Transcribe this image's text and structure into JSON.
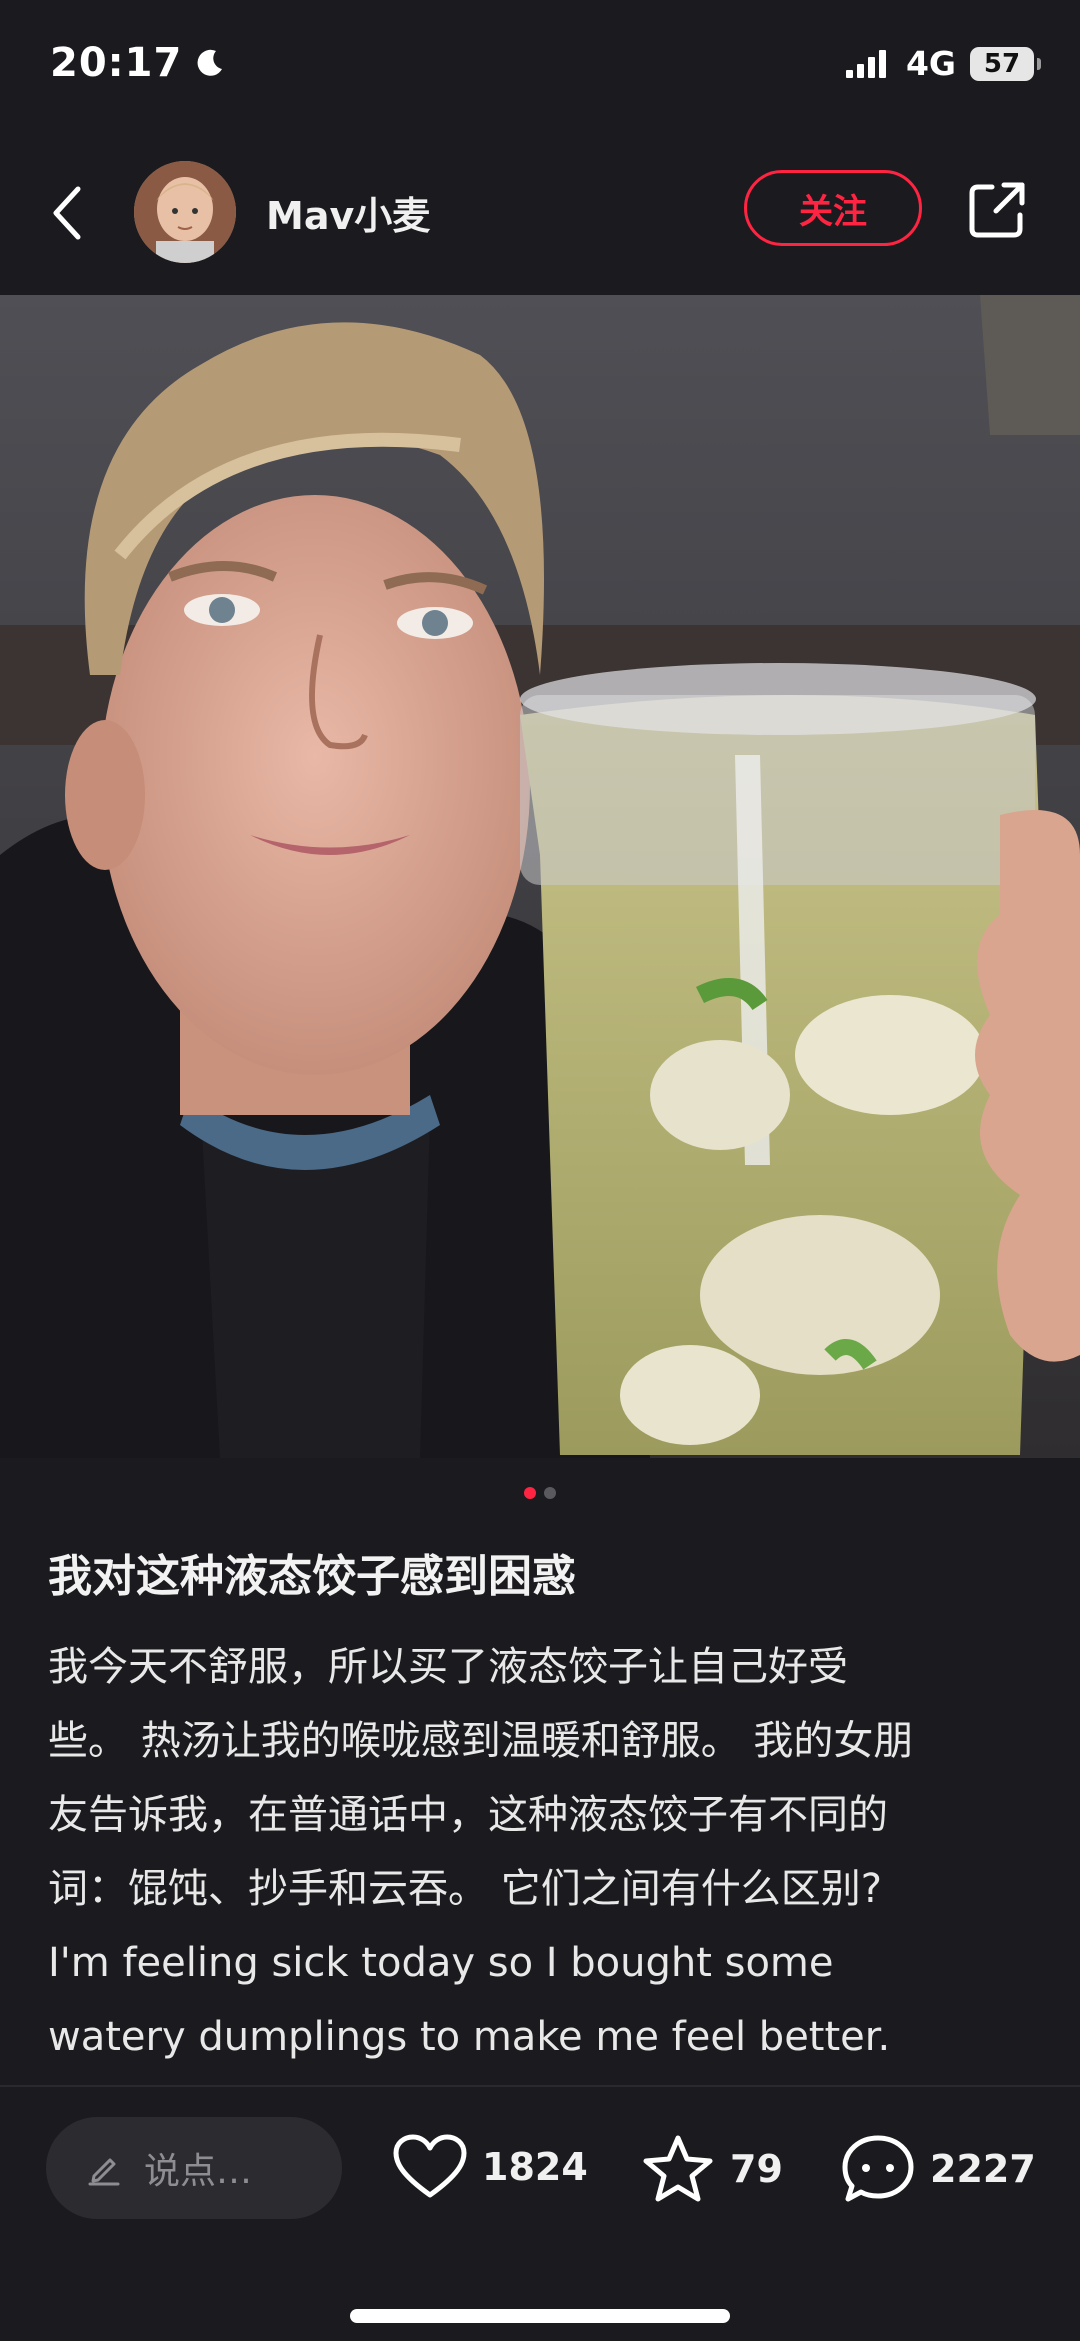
{
  "status_bar": {
    "time": "20:17",
    "network": "4G",
    "battery": "57"
  },
  "header": {
    "author_name": "Mav小麦",
    "follow_label": "关注"
  },
  "post": {
    "title": "我对这种液态饺子感到困惑",
    "body_lines": [
      "我今天不舒服，所以买了液态饺子让自己好受",
      "些。 热汤让我的喉咙感到温暖和舒服。 我的女朋",
      "友告诉我，在普通话中，这种液态饺子有不同的",
      "词：馄饨、抄手和云吞。 它们之间有什么区别?",
      "I'm feeling sick today so I bought some",
      "watery dumplings to make me feel better."
    ],
    "image_count": 2,
    "active_image": 1
  },
  "bottom_bar": {
    "comment_placeholder": "说点…",
    "likes": "1824",
    "favorites": "79",
    "comments": "2227"
  },
  "colors": {
    "accent": "#ff2442",
    "background": "#1b1b1f"
  }
}
